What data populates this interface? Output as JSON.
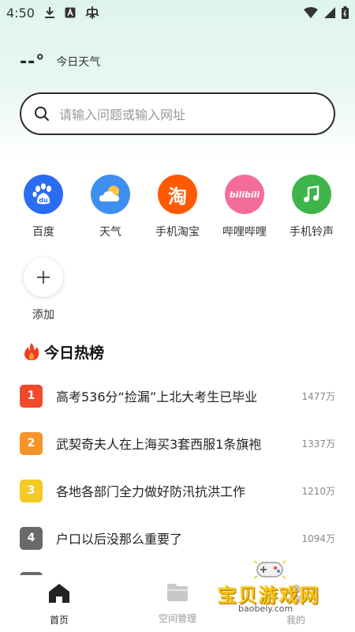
{
  "status_bar": {
    "time": "4:50",
    "icons_left": [
      "download-icon",
      "a-icon",
      "bug-icon"
    ],
    "icons_right": [
      "wifi-icon",
      "signal-icon",
      "battery-icon"
    ]
  },
  "weather": {
    "temp": "--°",
    "label": "今日天气"
  },
  "search": {
    "placeholder": "请输入问题或输入网址"
  },
  "shortcuts": [
    {
      "label": "百度",
      "icon": "baidu-paw-icon",
      "color": "#2b6df2"
    },
    {
      "label": "天气",
      "icon": "weather-cloud-sun-icon",
      "color": "#3e8ff0"
    },
    {
      "label": "手机淘宝",
      "icon": "taobao-icon",
      "color": "#ff5a00",
      "glyph": "淘"
    },
    {
      "label": "哔哩哔哩",
      "icon": "bilibili-icon",
      "color": "#f46d9a",
      "glyph": "bilibili"
    },
    {
      "label": "手机铃声",
      "icon": "music-note-icon",
      "color": "#3eb54a"
    }
  ],
  "add_shortcut": {
    "label": "添加"
  },
  "hot_list": {
    "title": "今日热榜",
    "items": [
      {
        "rank": "1",
        "text": "高考536分“捡漏”上北大考生已毕业",
        "count": "1477万",
        "color": "#f04a2c"
      },
      {
        "rank": "2",
        "text": "武契奇夫人在上海买3套西服1条旗袍",
        "count": "1337万",
        "color": "#f7932b"
      },
      {
        "rank": "3",
        "text": "各地各部门全力做好防汛抗洪工作",
        "count": "1210万",
        "color": "#f5c928"
      },
      {
        "rank": "4",
        "text": "户口以后没那么重要了",
        "count": "1094万",
        "color": "#6a6a6a"
      }
    ]
  },
  "bottom_nav": {
    "items": [
      {
        "label": "首页",
        "icon": "home-icon",
        "active": true
      },
      {
        "label": "空间管理",
        "icon": "folder-icon",
        "active": false
      },
      {
        "label": "我的",
        "icon": "profile-icon",
        "active": false
      }
    ]
  },
  "watermark": {
    "text": "宝贝游戏网",
    "url": "baobeiy.com"
  }
}
